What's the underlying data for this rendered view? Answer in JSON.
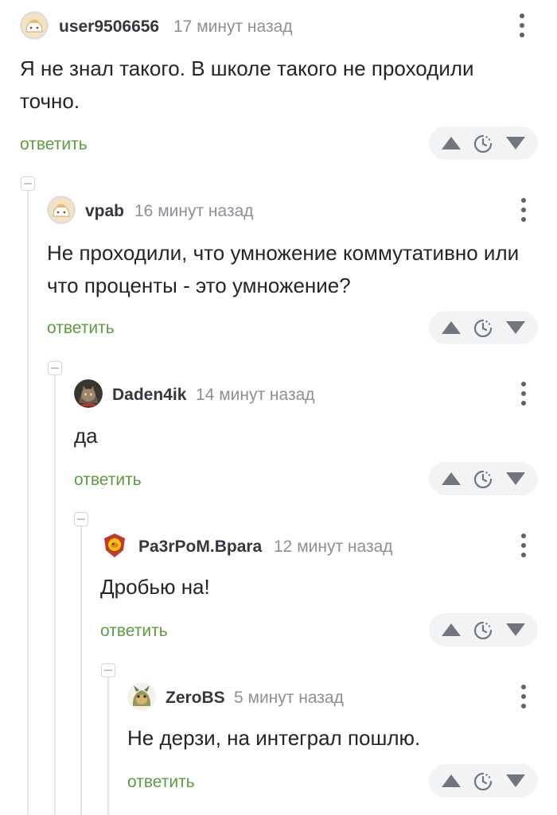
{
  "comments": [
    {
      "username": "user9506656",
      "time": "17 минут назад",
      "text": "Я не знал такого. В школе такого не проходили точно.",
      "reply_label": "ответить",
      "avatar": "default-avatar-icon"
    },
    {
      "username": "vpab",
      "time": "16 минут назад",
      "text": "Не проходили, что умножение коммутативно или что проценты - это умножение?",
      "reply_label": "ответить",
      "avatar": "default-avatar-icon"
    },
    {
      "username": "Daden4ik",
      "time": "14 минут назад",
      "text": "да",
      "reply_label": "ответить",
      "avatar": "cat-avatar-icon"
    },
    {
      "username": "Pa3rPoM.Bpara",
      "time": "12 минут назад",
      "text": "Дробью на!",
      "reply_label": "ответить",
      "avatar": "emblem-avatar-icon"
    },
    {
      "username": "ZeroBS",
      "time": "5 минут назад",
      "text": "Не дерзи, на интеграл пошлю.",
      "reply_label": "ответить",
      "avatar": "creature-avatar-icon"
    }
  ],
  "colors": {
    "reply_link": "#5e9b3f",
    "thread_line": "#e2e5e8",
    "vote_bar_bg": "#f2f3f5"
  }
}
